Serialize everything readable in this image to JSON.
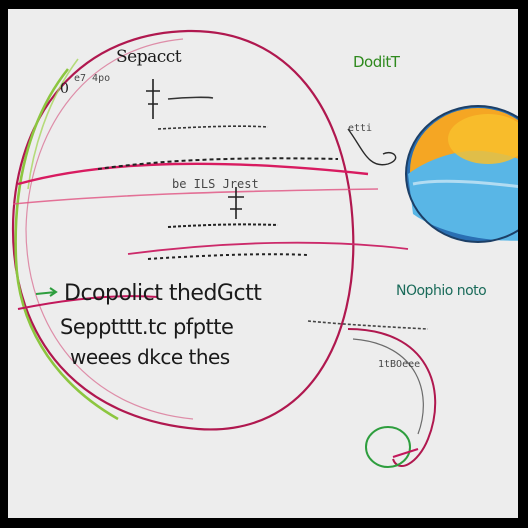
{
  "title": "Sepacct",
  "corner_mark": "0",
  "corner_small": "e7 4po",
  "right_label": "DoditT",
  "mid_label": "be ILS Jrest",
  "line1": "Dcopolict thedGctt",
  "line2": "Sepptttt.tc pfptte",
  "line3": "weees dkce thes",
  "right_mid_label": "NOophio noto",
  "small_right": "1tBOeee",
  "small_label_arrow": "etti",
  "colors": {
    "paper": "#ededed",
    "magenta": "#c2185b",
    "green": "#7cc242",
    "orange": "#f5a623",
    "blue": "#4aa7e0"
  }
}
